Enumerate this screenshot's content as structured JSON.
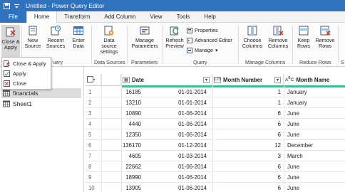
{
  "titlebar": {
    "title": "Untitled - Power Query Editor"
  },
  "menu": {
    "file": "File",
    "tabs": [
      "Home",
      "Transform",
      "Add Column",
      "View",
      "Tools",
      "Help"
    ]
  },
  "ribbon": {
    "close_apply": "Close &",
    "close_apply2": "Apply",
    "new_source": "New",
    "new_source2": "Source",
    "recent_sources": "Recent",
    "recent_sources2": "Sources",
    "enter_data": "Enter",
    "enter_data2": "Data",
    "data_source_settings": "Data source",
    "data_source_settings2": "settings",
    "manage_parameters": "Manage",
    "manage_parameters2": "Parameters",
    "refresh_preview": "Refresh",
    "refresh_preview2": "Preview",
    "properties": "Properties",
    "advanced_editor": "Advanced Editor",
    "manage": "Manage",
    "choose_columns": "Choose",
    "choose_columns2": "Columns",
    "remove_columns": "Remove",
    "remove_columns2": "Columns",
    "keep_rows": "Keep",
    "keep_rows2": "Rows",
    "remove_rows": "Remove",
    "remove_rows2": "Rows",
    "groups": {
      "query_partial": "uery",
      "data_sources": "Data Sources",
      "parameters": "Parameters",
      "query": "Query",
      "manage_columns": "Manage Columns",
      "reduce_rows": "Reduce Rows",
      "sort_partial": "S"
    }
  },
  "dropdown": {
    "items": [
      "Close & Apply",
      "Apply",
      "Close"
    ]
  },
  "queries": [
    "financials",
    "Sheet1"
  ],
  "table": {
    "columns": [
      {
        "type": "ABC123",
        "name": ""
      },
      {
        "type": "cal",
        "name": "Date"
      },
      {
        "type": "123",
        "name": "Month Number"
      },
      {
        "type": "ABC",
        "name": "Month Name"
      }
    ],
    "rows": [
      [
        "1",
        "16185",
        "01-01-2014",
        "1",
        "January"
      ],
      [
        "2",
        "13210",
        "01-01-2014",
        "1",
        "January"
      ],
      [
        "3",
        "10890",
        "01-06-2014",
        "6",
        "June"
      ],
      [
        "4",
        "4440",
        "01-06-2014",
        "6",
        "June"
      ],
      [
        "5",
        "12350",
        "01-06-2014",
        "6",
        "June"
      ],
      [
        "6",
        "136170",
        "01-12-2014",
        "12",
        "December"
      ],
      [
        "7",
        "4605",
        "01-03-2014",
        "3",
        "March"
      ],
      [
        "8",
        "22662",
        "01-06-2014",
        "6",
        "June"
      ],
      [
        "9",
        "18990",
        "01-06-2014",
        "6",
        "June"
      ],
      [
        "10",
        "13905",
        "01-06-2014",
        "6",
        "June"
      ]
    ]
  },
  "colors": {
    "accent": "#2f72bd",
    "green_bar": "#3fbf8f"
  }
}
